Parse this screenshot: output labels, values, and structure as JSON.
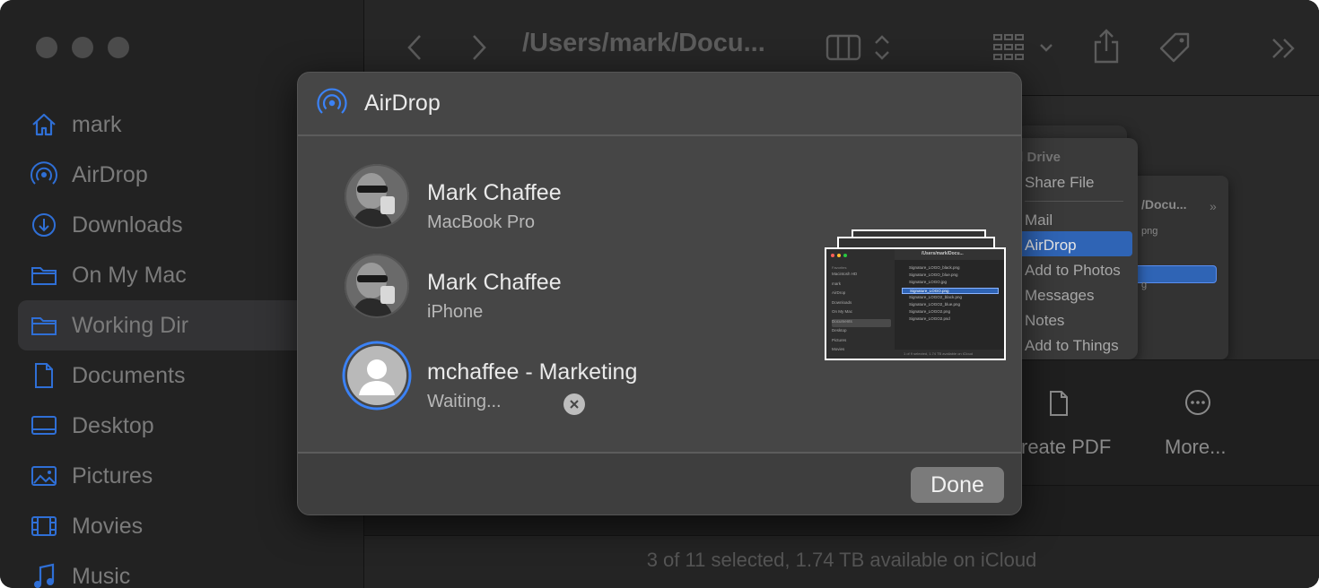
{
  "finder": {
    "sidebar": {
      "items": [
        {
          "label": "mark",
          "icon": "home-icon"
        },
        {
          "label": "AirDrop",
          "icon": "airdrop-icon"
        },
        {
          "label": "Downloads",
          "icon": "downloads-icon"
        },
        {
          "label": "On My Mac",
          "icon": "folder-icon"
        },
        {
          "label": "Working Dir",
          "icon": "folder-icon",
          "selected": true
        },
        {
          "label": "Documents",
          "icon": "document-icon"
        },
        {
          "label": "Desktop",
          "icon": "desktop-icon"
        },
        {
          "label": "Pictures",
          "icon": "pictures-icon"
        },
        {
          "label": "Movies",
          "icon": "movies-icon"
        },
        {
          "label": "Music",
          "icon": "music-icon"
        }
      ]
    },
    "toolbar": {
      "path_title": "/Users/mark/Docu..."
    },
    "share_menu": {
      "items": [
        "ud Drive",
        "Share File",
        "Mail",
        "AirDrop",
        "Add to Photos",
        "Messages",
        "Notes",
        "Add to Things"
      ],
      "highlighted": "AirDrop"
    },
    "back_window": {
      "title": "/Docu...",
      "items": [
        "png",
        "g"
      ]
    },
    "actions": {
      "create_pdf": "reate PDF",
      "more": "More..."
    },
    "status": "3 of 11 selected, 1.74 TB available on iCloud"
  },
  "dialog": {
    "title": "AirDrop",
    "people": [
      {
        "name": "Mark Chaffee",
        "device": "MacBook Pro"
      },
      {
        "name": "Mark Chaffee",
        "device": "iPhone"
      },
      {
        "name": "mchaffee - Marketing",
        "device": "Waiting..."
      }
    ],
    "preview": {
      "sidebar_heading": "Favorites",
      "sidebar_items": [
        "Macintosh HD",
        "mark",
        "AirDrop",
        "Downloads",
        "On My Mac",
        "Documents",
        "Desktop",
        "Pictures",
        "Movies"
      ],
      "path": "/Users/mark/Docu...",
      "files": [
        "Signature_LOGO_black.png",
        "Signature_LOGO_blue.png",
        "Signature_LOGO.jpg",
        "Signature_LOGO.png",
        "Signature_LOGO2_black.png",
        "Signature_LOGO2_blue.png",
        "Signature_LOGO2.png",
        "Signature_LOGO2.psd"
      ],
      "selected_file": 3,
      "status": "1 of 9 selected, 1.74 TB available on iCloud"
    },
    "done_label": "Done"
  },
  "colors": {
    "accent": "#2f64b5",
    "airdrop_blue": "#3b82f6",
    "dialog_bg": "#464646"
  }
}
